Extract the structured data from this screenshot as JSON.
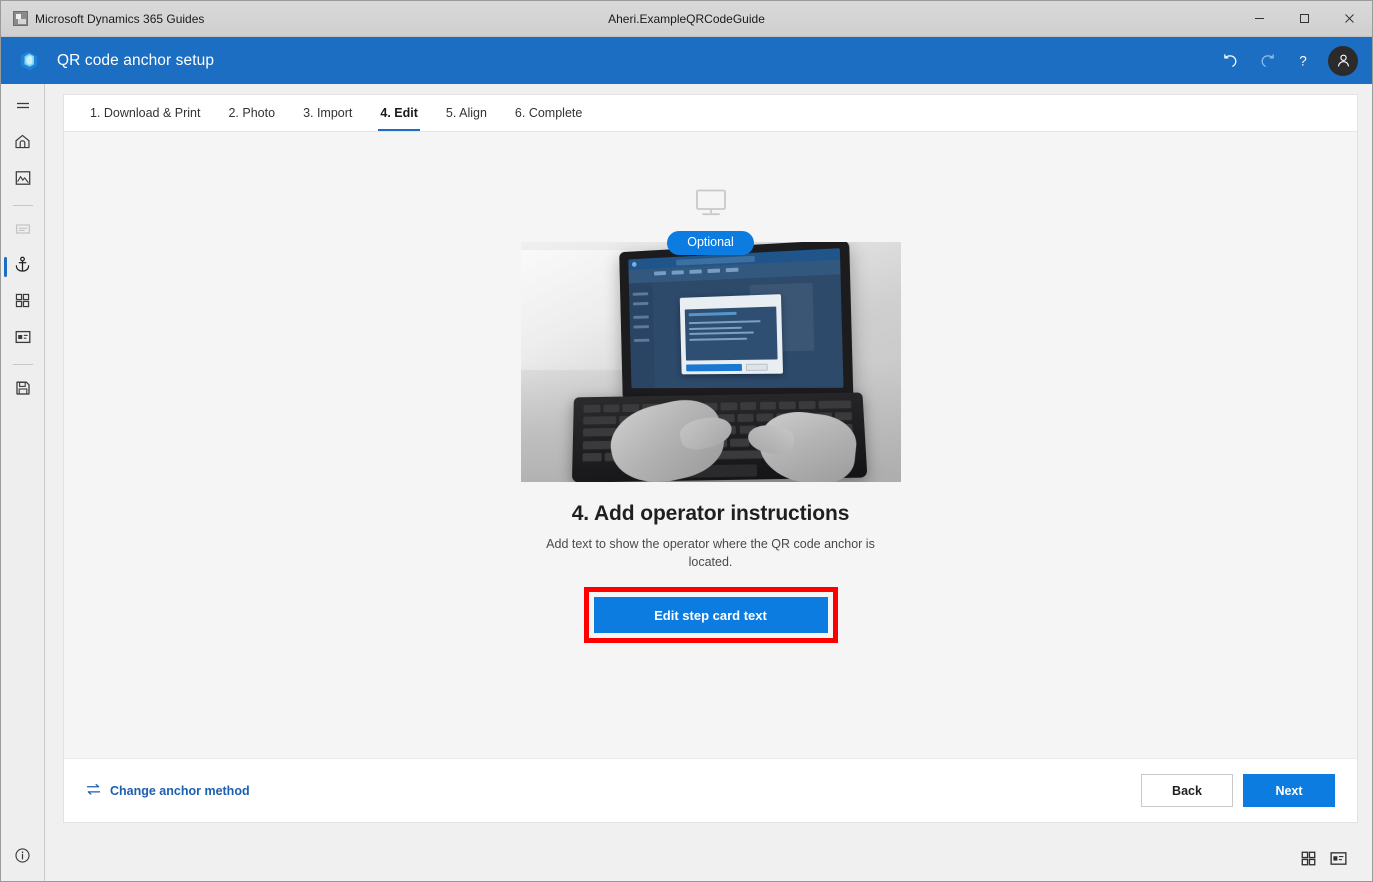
{
  "titlebar": {
    "app_icon": "app-window-icon",
    "app_name": "Microsoft Dynamics 365 Guides",
    "document_title": "Aheri.ExampleQRCodeGuide",
    "minimize_label": "─",
    "maximize_label": "☐",
    "close_label": "✕"
  },
  "appbar": {
    "logo_icon": "dynamics-guides-logo",
    "title": "QR code anchor setup",
    "actions": [
      {
        "icon": "undo-icon",
        "label": "Undo",
        "state": "enabled"
      },
      {
        "icon": "redo-icon",
        "label": "Redo",
        "state": "disabled"
      },
      {
        "icon": "help-icon",
        "label": "Help",
        "state": "enabled"
      }
    ],
    "account": {
      "icon": "account-avatar-icon",
      "label": "Account"
    },
    "accent_color": "#1b6ec2"
  },
  "sidebar": {
    "items": [
      {
        "id": "menu",
        "icon": "hamburger-menu-icon",
        "label": "Menu",
        "active": false,
        "disabled": false
      },
      {
        "id": "home",
        "icon": "home-icon",
        "label": "Home",
        "active": false,
        "disabled": false
      },
      {
        "id": "media",
        "icon": "image-icon",
        "label": "Media",
        "active": false,
        "disabled": false
      },
      {
        "id": "steps",
        "icon": "step-list-icon",
        "label": "Steps",
        "active": false,
        "disabled": true
      },
      {
        "id": "anchor",
        "icon": "anchor-icon",
        "label": "Anchor",
        "active": true,
        "disabled": false
      },
      {
        "id": "assets",
        "icon": "grid-icon",
        "label": "3D assets",
        "active": false,
        "disabled": false
      },
      {
        "id": "card",
        "icon": "step-card-icon",
        "label": "Step card",
        "active": false,
        "disabled": false
      },
      {
        "id": "save",
        "icon": "save-icon",
        "label": "Save",
        "active": false,
        "disabled": false
      }
    ],
    "info": {
      "icon": "info-icon",
      "label": "Information"
    }
  },
  "tabs": [
    {
      "label": "1. Download & Print",
      "active": false
    },
    {
      "label": "2. Photo",
      "active": false
    },
    {
      "label": "3. Import",
      "active": false
    },
    {
      "label": "4. Edit",
      "active": true
    },
    {
      "label": "5. Align",
      "active": false
    },
    {
      "label": "6. Complete",
      "active": false
    }
  ],
  "content": {
    "device_icon": "desktop-monitor-icon",
    "badge": "Optional",
    "badge_color": "#0d7ce0",
    "illustration": {
      "name": "laptop-typing-photo",
      "alt": "Hands typing on a laptop showing the Guides PC app with a dialog open"
    },
    "heading": "4. Add operator instructions",
    "description": "Add text to show the operator where the QR code anchor is located.",
    "cta": {
      "label": "Edit step card text",
      "color": "#0d7ce0",
      "highlight_color": "#ff0000",
      "highlighted": true
    }
  },
  "footer": {
    "change_anchor": {
      "icon": "swap-arrows-icon",
      "label": "Change anchor method"
    },
    "back": "Back",
    "next": "Next"
  },
  "statusbar": {
    "info_icon": "info-icon",
    "right_icons": [
      {
        "icon": "grid-view-icon",
        "label": "Grid view"
      },
      {
        "icon": "card-view-icon",
        "label": "Card view"
      }
    ]
  }
}
